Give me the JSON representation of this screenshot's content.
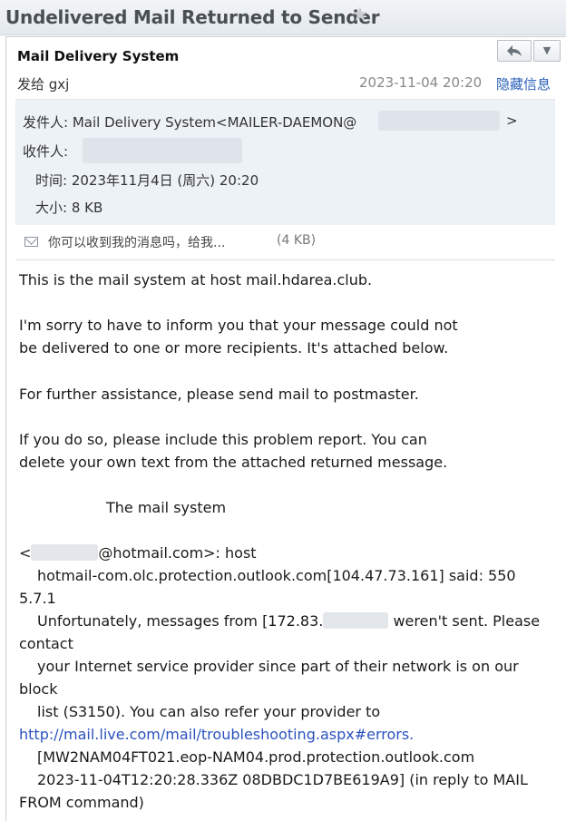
{
  "title": "Undelivered Mail Returned to Sender",
  "star_icon": "star-icon",
  "header": {
    "sender_name": "Mail Delivery System",
    "recipient_line": "发给 gxj",
    "date": "2023-11-04 20:20",
    "hide_label": "隐藏信息",
    "reply_icon": "reply-icon",
    "more_icon": "chevron-down-icon"
  },
  "details": {
    "from_label": "发件人:",
    "from_name": "Mail Delivery System",
    "from_addr": "<MAILER-DAEMON@",
    "from_close": ">",
    "to_label": "收件人:",
    "time_label": "时间:",
    "time_value": "2023年11月4日 (周六) 20:20",
    "size_label": "大小:",
    "size_value": "8 KB"
  },
  "attachment": {
    "name": "你可以收到我的消息吗，给我...",
    "size": "(4 KB)"
  },
  "body": {
    "line1": "This is the mail system at host mail.hdarea.club.",
    "line2": "I'm sorry to have to inform you that your message could not",
    "line3": "be delivered to one or more recipients. It's attached below.",
    "line4": "For further assistance, please send mail to postmaster.",
    "line5": "If you do so, please include this problem report. You can",
    "line6": "delete your own text from the attached returned message.",
    "line7": "The mail system",
    "line8_open": "<",
    "line8_rest": "@hotmail.com>: host",
    "line9": "hotmail-com.olc.protection.outlook.com[104.47.73.161] said: 550",
    "line10": "5.7.1",
    "line11a": "Unfortunately, messages from [172.83.",
    "line11b": "weren't sent. Please",
    "line12": "contact",
    "line13": "your Internet service provider since part of their network is on our",
    "line14": "block",
    "line15": "list (S3150). You can also refer your provider to",
    "line16": "http://mail.live.com/mail/troubleshooting.aspx#errors.",
    "line17": "[MW2NAM04FT021.eop-NAM04.prod.protection.outlook.com",
    "line18": "2023-11-04T12:20:28.336Z 08DBDC1D7BE619A9] (in reply to MAIL",
    "line19": "FROM command)"
  }
}
